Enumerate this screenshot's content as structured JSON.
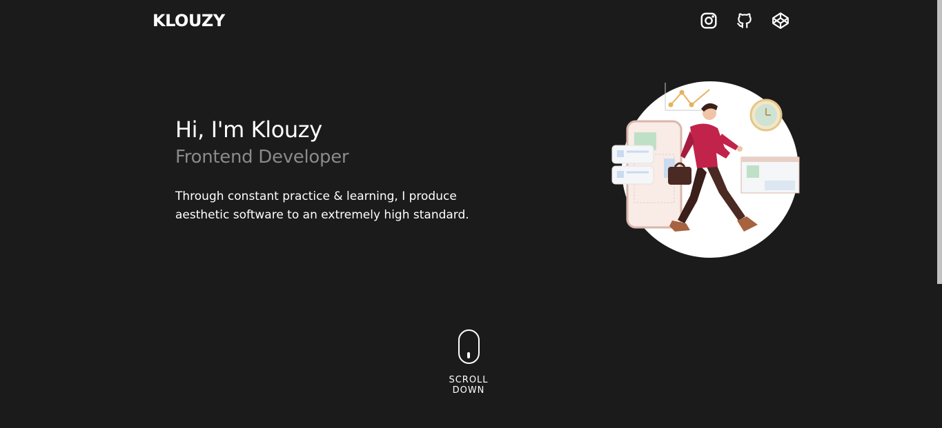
{
  "header": {
    "logo": "KLOUZY",
    "socials": [
      {
        "icon": "instagram-icon"
      },
      {
        "icon": "github-icon"
      },
      {
        "icon": "codepen-icon"
      }
    ]
  },
  "hero": {
    "title": "Hi, I'm Klouzy",
    "subtitle": "Frontend Developer",
    "description_line1": "Through constant practice & learning, I produce",
    "description_line2": "aesthetic software to an extremely high standard."
  },
  "scroll": {
    "line1": "SCROLL",
    "line2": "DOWN"
  },
  "colors": {
    "background": "#1b1b1b",
    "text": "#ffffff",
    "subtitle": "#8a8a8a"
  }
}
